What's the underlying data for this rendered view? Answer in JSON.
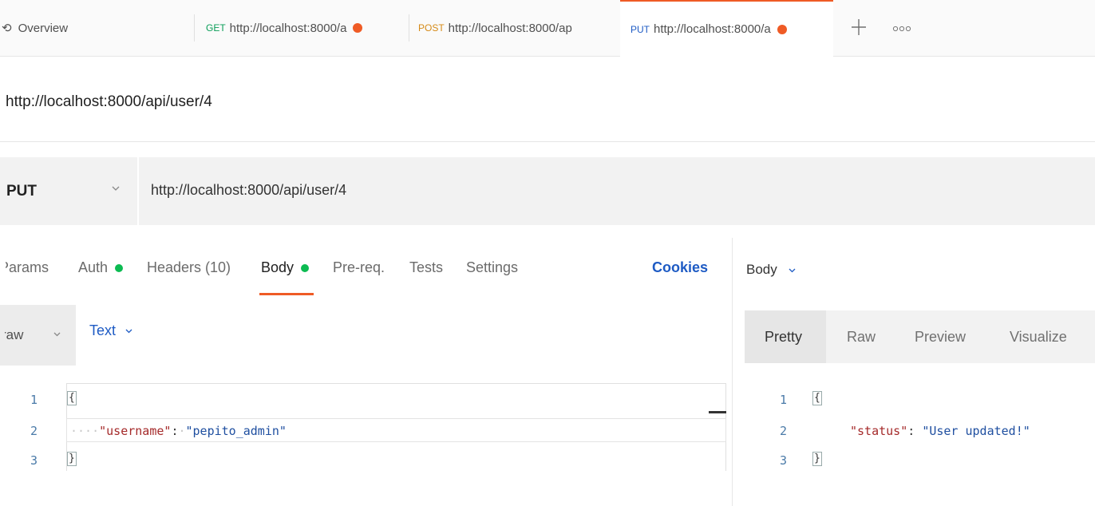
{
  "tabs": [
    {
      "label": "Overview"
    },
    {
      "method": "GET",
      "url": "http://localhost:8000/a"
    },
    {
      "method": "POST",
      "url": "http://localhost:8000/ap"
    },
    {
      "method": "PUT",
      "url": "http://localhost:8000/a"
    }
  ],
  "tab_colors": {
    "GET": "#0a9d58",
    "POST": "#d58a17",
    "PUT": "#1e5bc4",
    "unsaved_dot": "#ef5b25"
  },
  "request": {
    "title": "http://localhost:8000/api/user/4",
    "method": "PUT",
    "url": "http://localhost:8000/api/user/4"
  },
  "request_tabs": {
    "params": "Params",
    "auth": "Auth",
    "headers": "Headers (10)",
    "body": "Body",
    "prereq": "Pre-req.",
    "tests": "Tests",
    "settings": "Settings",
    "cookies": "Cookies"
  },
  "body_options": {
    "mode": "raw",
    "format": "Text"
  },
  "request_body": {
    "line_numbers": [
      "1",
      "2",
      "3"
    ],
    "open_brace": "{",
    "key": "\"username\"",
    "colon": ":",
    "value": "\"pepito_admin\"",
    "close_brace": "}"
  },
  "response": {
    "section_label": "Body",
    "view_tabs": [
      "Pretty",
      "Raw",
      "Preview",
      "Visualize"
    ],
    "line_numbers": [
      "1",
      "2",
      "3"
    ],
    "open_brace": "{",
    "key": "\"status\"",
    "colon": ":",
    "value": "\"User updated!\"",
    "close_brace": "}"
  }
}
